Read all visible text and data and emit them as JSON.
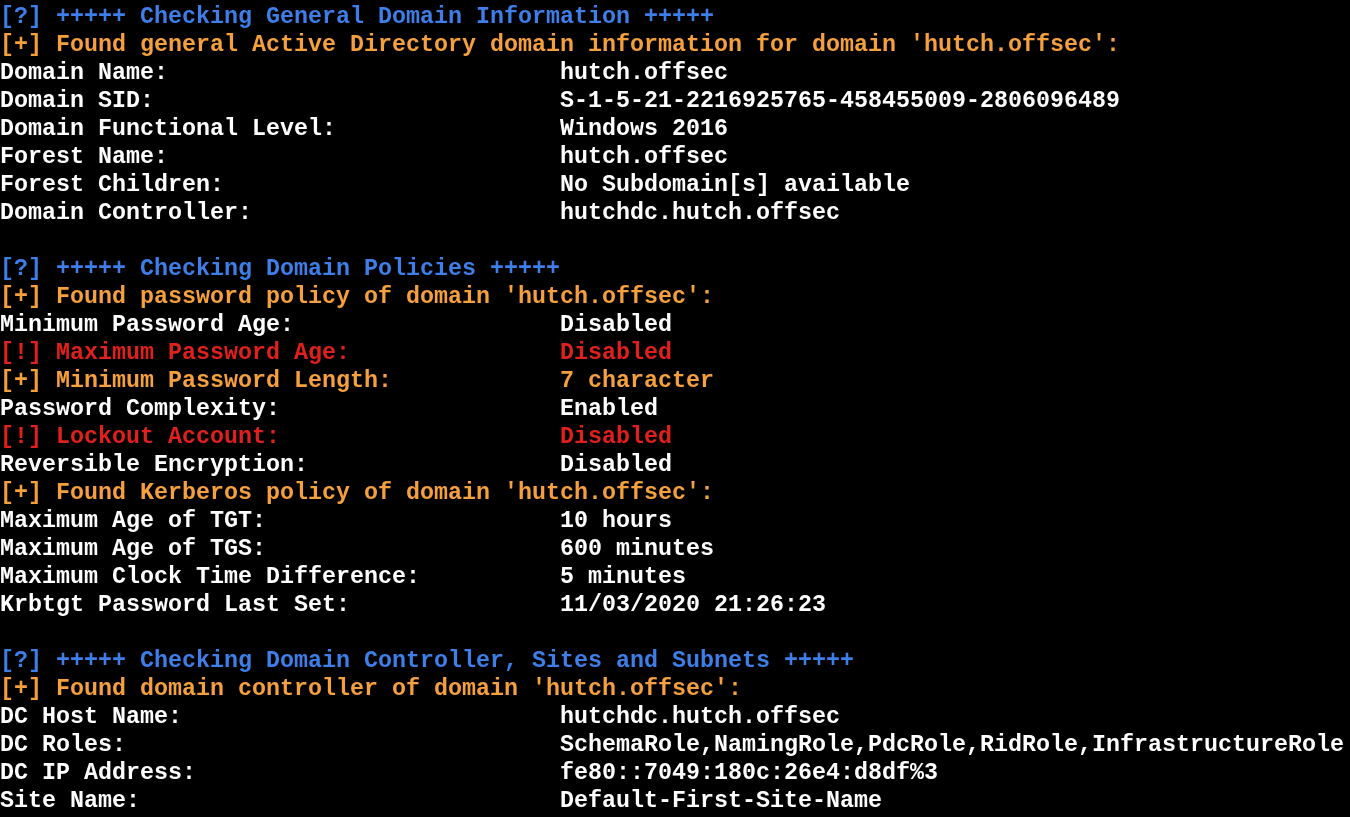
{
  "sections": [
    {
      "heading": "[?] +++++ Checking General Domain Information +++++",
      "entries": [
        {
          "kind": "found",
          "text": "[+] Found general Active Directory domain information for domain 'hutch.offsec':"
        },
        {
          "kind": "field",
          "label": "Domain Name:",
          "value": "hutch.offsec"
        },
        {
          "kind": "field",
          "label": "Domain SID:",
          "value": "S-1-5-21-2216925765-458455009-2806096489"
        },
        {
          "kind": "field",
          "label": "Domain Functional Level:",
          "value": "Windows 2016"
        },
        {
          "kind": "field",
          "label": "Forest Name:",
          "value": "hutch.offsec"
        },
        {
          "kind": "field",
          "label": "Forest Children:",
          "value": "No Subdomain[s] available"
        },
        {
          "kind": "field",
          "label": "Domain Controller:",
          "value": "hutchdc.hutch.offsec"
        }
      ]
    },
    {
      "heading": "[?] +++++ Checking Domain Policies +++++",
      "entries": [
        {
          "kind": "found",
          "text": "[+] Found password policy of domain 'hutch.offsec':"
        },
        {
          "kind": "field",
          "label": "Minimum Password Age:",
          "value": "Disabled"
        },
        {
          "kind": "warning",
          "label": "[!] Maximum Password Age:",
          "value": "Disabled"
        },
        {
          "kind": "notice",
          "label": "[+] Minimum Password Length:",
          "value": "7 character"
        },
        {
          "kind": "field",
          "label": "Password Complexity:",
          "value": "Enabled"
        },
        {
          "kind": "warning",
          "label": "[!] Lockout Account:",
          "value": "Disabled"
        },
        {
          "kind": "field",
          "label": "Reversible Encryption:",
          "value": "Disabled"
        },
        {
          "kind": "found",
          "text": "[+] Found Kerberos policy of domain 'hutch.offsec':"
        },
        {
          "kind": "field",
          "label": "Maximum Age of TGT:",
          "value": "10 hours"
        },
        {
          "kind": "field",
          "label": "Maximum Age of TGS:",
          "value": "600 minutes"
        },
        {
          "kind": "field",
          "label": "Maximum Clock Time Difference:",
          "value": "5 minutes"
        },
        {
          "kind": "field",
          "label": "Krbtgt Password Last Set:",
          "value": "11/03/2020 21:26:23"
        }
      ]
    },
    {
      "heading": "[?] +++++ Checking Domain Controller, Sites and Subnets +++++",
      "entries": [
        {
          "kind": "found",
          "text": "[+] Found domain controller of domain 'hutch.offsec':"
        },
        {
          "kind": "field",
          "label": "DC Host Name:",
          "value": "hutchdc.hutch.offsec"
        },
        {
          "kind": "field",
          "label": "DC Roles:",
          "value": "SchemaRole,NamingRole,PdcRole,RidRole,InfrastructureRole"
        },
        {
          "kind": "field",
          "label": "DC IP Address:",
          "value": "fe80::7049:180c:26e4:d8df%3"
        },
        {
          "kind": "field",
          "label": "Site Name:",
          "value": "Default-First-Site-Name"
        }
      ]
    }
  ]
}
